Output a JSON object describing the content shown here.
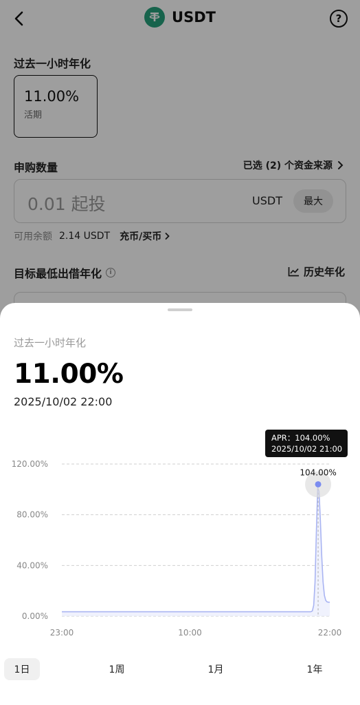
{
  "header": {
    "title": "USDT",
    "back_icon": "chevron-left-icon",
    "help_icon": "question-mark-icon",
    "help_glyph": "?"
  },
  "rate_section": {
    "label": "过去一小时年化",
    "rate": "11.00%",
    "type": "活期"
  },
  "subscribe": {
    "label": "申购数量",
    "source_link": "已选 (2) 个资金来源",
    "amount_placeholder": "0.01 起投",
    "unit": "USDT",
    "max_label": "最大",
    "balance_label": "可用余额",
    "balance_value": "2.14 USDT",
    "deposit_link": "充币/买币"
  },
  "target": {
    "label": "目标最低出借年化",
    "history_link": "历史年化",
    "info_glyph": "i"
  },
  "sheet": {
    "label": "过去一小时年化",
    "value": "11.00%",
    "time": "2025/10/02 22:00",
    "tooltip_line1": "APR：104.00%",
    "tooltip_line2": "2025/10/02 21:00",
    "peak_label": "104.00%",
    "range_tabs": [
      {
        "label": "1日",
        "active": true
      },
      {
        "label": "1周",
        "active": false
      },
      {
        "label": "1月",
        "active": false
      },
      {
        "label": "1年",
        "active": false
      }
    ]
  },
  "colors": {
    "line": "#a9b4f2",
    "line_fill": "#e9ecfc",
    "marker": "#7b8cf0",
    "marker_halo": "#dcdcdc",
    "grid": "#cfcfcf",
    "tooltip_bg": "#111111",
    "token_green": "#26a17b"
  },
  "chart_data": {
    "type": "area",
    "x_ticks": [
      "23:00",
      "10:00",
      "22:00"
    ],
    "y_ticks": [
      "0.00%",
      "40.00%",
      "80.00%",
      "120.00%"
    ],
    "ylim": [
      0,
      120
    ],
    "grid": true,
    "series": [
      {
        "x": [
          "23:00",
          "21:00",
          "22:00"
        ],
        "values": [
          3.5,
          104,
          11
        ]
      }
    ],
    "highlight": {
      "x": "21:00",
      "value": 104
    }
  }
}
